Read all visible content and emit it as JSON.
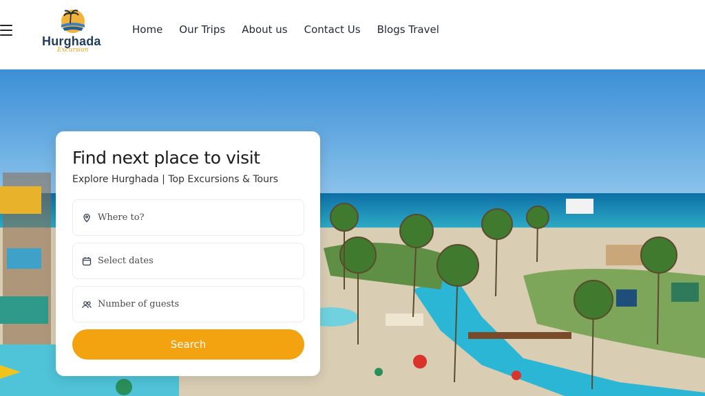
{
  "brand": {
    "name": "Hurghada",
    "tagline": "Excursion"
  },
  "nav": {
    "items": [
      "Home",
      "Our Trips",
      "About us",
      "Contact Us",
      "Blogs Travel"
    ]
  },
  "search_card": {
    "title": "Find next place to visit",
    "subtitle": "Explore Hurghada | Top Excursions & Tours",
    "destination_placeholder": "Where to?",
    "dates_placeholder": "Select dates",
    "guests_placeholder": "Number of guests",
    "search_label": "Search"
  },
  "icons": {
    "menu": "hamburger-icon",
    "destination": "map-pin-icon",
    "dates": "calendar-icon",
    "guests": "users-icon"
  },
  "colors": {
    "accent": "#f2a30f",
    "brand_dark": "#1f3d5a",
    "brand_gold": "#e7a41c"
  }
}
